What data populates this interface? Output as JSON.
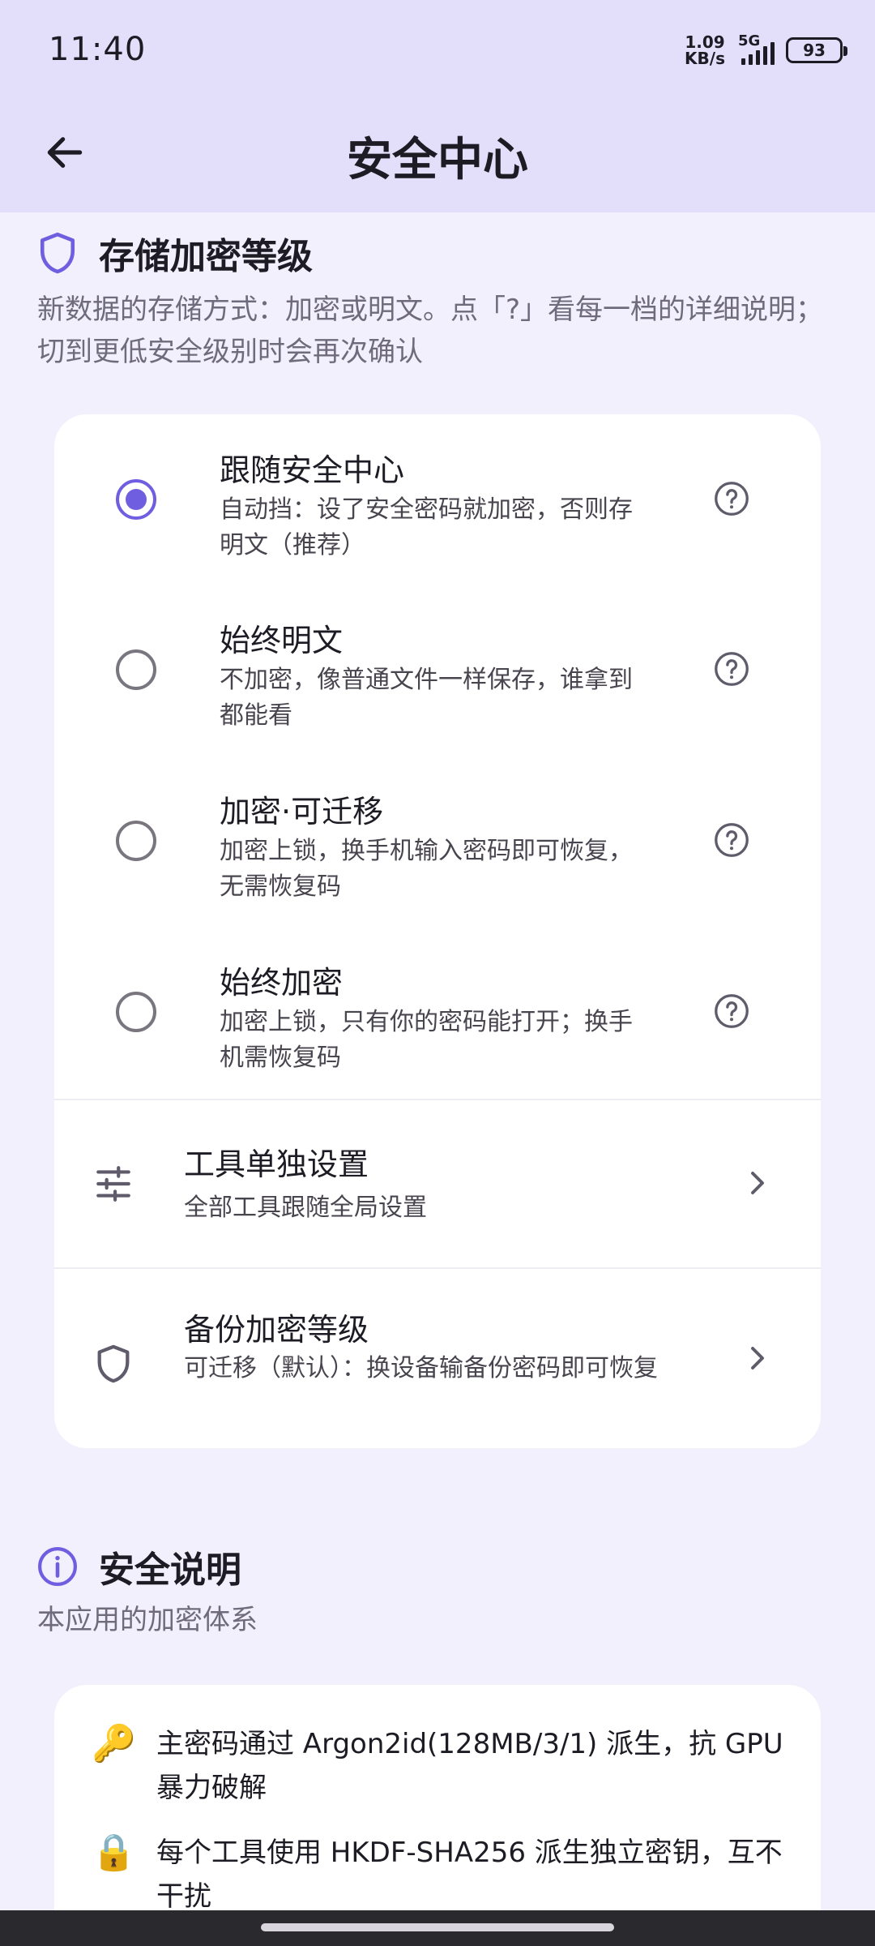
{
  "status_bar": {
    "time": "11:40",
    "net_speed_value": "1.09",
    "net_speed_unit": "KB/s",
    "network": "5G",
    "battery": "93"
  },
  "app_bar": {
    "title": "安全中心",
    "back_icon": "arrow-back-icon"
  },
  "storage_section": {
    "icon": "shield-icon",
    "title": "存储加密等级",
    "description": "新数据的存储方式：加密或明文。点「?」看每一档的详细说明；切到更低安全级别时会再次确认",
    "selected_index": 0,
    "options": [
      {
        "title": "跟随安全中心",
        "subtitle": "自动挡：设了安全密码就加密，否则存明文（推荐）"
      },
      {
        "title": "始终明文",
        "subtitle": "不加密，像普通文件一样保存，谁拿到都能看"
      },
      {
        "title": "加密·可迁移",
        "subtitle": "加密上锁，换手机输入密码即可恢复，无需恢复码"
      },
      {
        "title": "始终加密",
        "subtitle": "加密上锁，只有你的密码能打开；换手机需恢复码"
      }
    ],
    "tool_settings": {
      "icon": "tune-icon",
      "title": "工具单独设置",
      "subtitle": "全部工具跟随全局设置"
    },
    "backup_level": {
      "icon": "shield-outline-icon",
      "title": "备份加密等级",
      "subtitle": "可迁移（默认）：换设备输备份密码即可恢复"
    }
  },
  "security_info": {
    "icon": "info-icon",
    "title": "安全说明",
    "description": "本应用的加密体系",
    "items": [
      {
        "emoji": "🔑",
        "text": "主密码通过 Argon2id(128MB/3/1) 派生，抗 GPU 暴力破解"
      },
      {
        "emoji": "🔒",
        "text": "每个工具使用 HKDF-SHA256 派生独立密钥，互不干扰"
      }
    ]
  },
  "colors": {
    "header_bg": "#e3dffa",
    "page_bg": "#f2f0fc",
    "accent": "#6f5fe0"
  }
}
